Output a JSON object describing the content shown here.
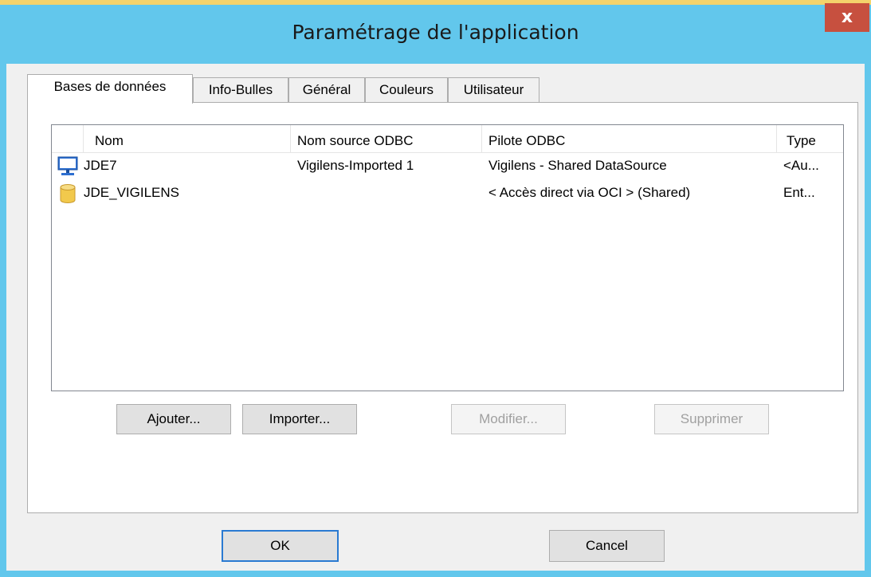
{
  "window": {
    "title": "Paramétrage de l'application",
    "close_label": "x"
  },
  "tabs": [
    {
      "label": "Bases de données",
      "active": true
    },
    {
      "label": "Info-Bulles",
      "active": false
    },
    {
      "label": "Général",
      "active": false
    },
    {
      "label": "Couleurs",
      "active": false
    },
    {
      "label": "Utilisateur",
      "active": false
    }
  ],
  "list": {
    "columns": [
      "Nom",
      "Nom source ODBC",
      "Pilote ODBC",
      "Type"
    ],
    "rows": [
      {
        "icon": "computer-icon",
        "name": "JDE7",
        "odbc_source": "Vigilens-Imported 1",
        "driver": "Vigilens - Shared DataSource",
        "type": "<Au..."
      },
      {
        "icon": "database-icon",
        "name": "JDE_VIGILENS",
        "odbc_source": "",
        "driver": "< Accès direct via OCI > (Shared)",
        "type": "Ent..."
      }
    ]
  },
  "actions": {
    "add": "Ajouter...",
    "import": "Importer...",
    "modify": "Modifier...",
    "delete": "Supprimer"
  },
  "footer": {
    "ok": "OK",
    "cancel": "Cancel"
  },
  "colors": {
    "frame": "#62c7ec",
    "close": "#c7503f",
    "focus": "#2a7ad2"
  }
}
